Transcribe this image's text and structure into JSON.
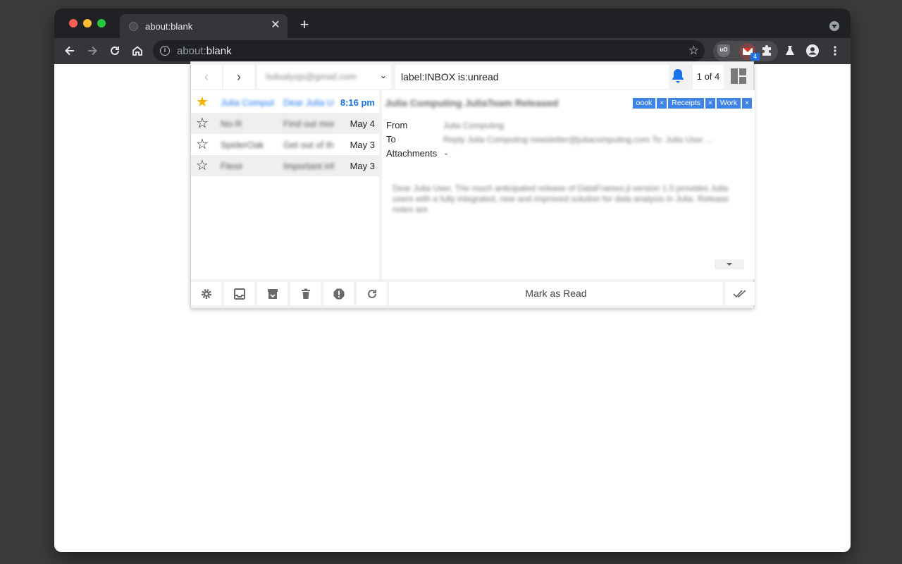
{
  "browser": {
    "tab_title": "about:blank",
    "tab_close": "✕",
    "new_tab": "+",
    "url_prefix": "about:",
    "url_host": "blank",
    "extension_badge": "4"
  },
  "popup": {
    "account": "lsdoalysjs@gmail.com",
    "query": "label:INBOX is:unread",
    "counter": "1 of 4",
    "messages": [
      {
        "starred": true,
        "unread": true,
        "from": "Julia Computing",
        "subject": "Dear Julia User",
        "date": "8:16 pm"
      },
      {
        "starred": false,
        "unread": false,
        "from": "No-R",
        "subject": "Find out more",
        "date": "May 4"
      },
      {
        "starred": false,
        "unread": false,
        "from": "SpiderOak",
        "subject": "Get out of the",
        "date": "May 3"
      },
      {
        "starred": false,
        "unread": false,
        "from": "Flexir",
        "subject": "Important info",
        "date": "May 3"
      }
    ],
    "reader": {
      "subject": "Julia Computing JuliaTeam Released",
      "labels": [
        "oook",
        "Receipts",
        "Work"
      ],
      "label_remove": "×",
      "from_label": "From",
      "from_value": "Julia Computing",
      "to_label": "To",
      "to_value": "Reply Julia Computing newsletter@juliacomputing.com To: Julia User ...",
      "attachments_label": "Attachments",
      "attachments_value": "-",
      "body": "Dear Julia User, The much anticipated release of DataFrames.jl version 1.0 provides Julia users with a fully integrated, new and improved solution for data analysis in Julia. Release notes are"
    },
    "footer": {
      "mark_read": "Mark as Read"
    }
  },
  "colors": {
    "accent": "#1a73e8",
    "label_chip": "#3f84e5",
    "star_on": "#f4b400"
  }
}
